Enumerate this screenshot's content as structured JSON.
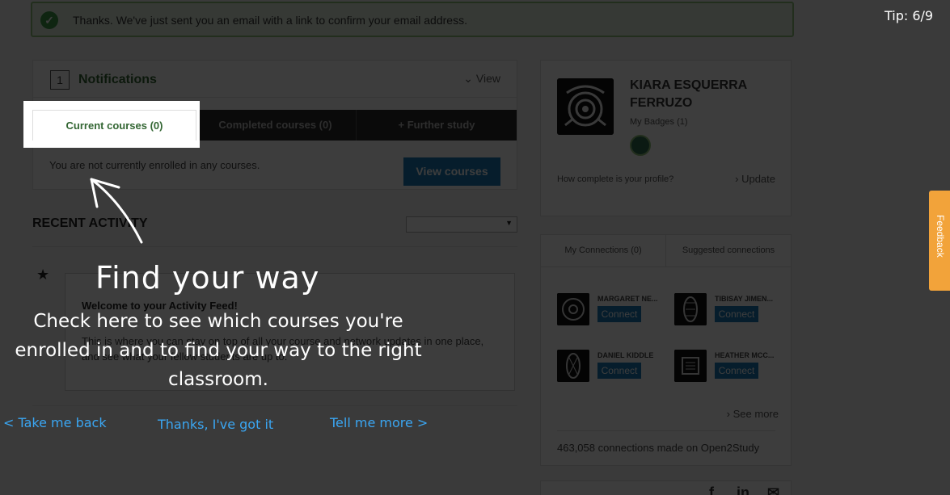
{
  "alert": {
    "message": "Thanks. We've just sent you an email with a link to confirm your email address."
  },
  "notifications": {
    "count": "1",
    "title": "Notifications",
    "view_label": "View",
    "tabs": [
      "Current courses (0)",
      "Completed courses (0)",
      "+ Further study"
    ],
    "empty_text": "You are not currently enrolled in any courses.",
    "view_courses_label": "View courses"
  },
  "activity": {
    "title": "RECENT ACTIVITY",
    "feed_title": "Welcome to your Activity Feed!",
    "feed_text": "This is where you can stay on top of all your course and network updates in one place, and see what your fellow students are up to."
  },
  "profile": {
    "name": "KIARA ESQUERRA FERRUZO",
    "badges_label": "My Badges (1)",
    "complete_question": "How complete is your profile?",
    "update_label": "Update"
  },
  "connections": {
    "tabs": [
      "My Connections (0)",
      "Suggested connections"
    ],
    "people": [
      {
        "name": "MARGARET NE...",
        "action": "Connect"
      },
      {
        "name": "TIBISAY JIMEN...",
        "action": "Connect"
      },
      {
        "name": "DANIEL KIDDLE",
        "action": "Connect"
      },
      {
        "name": "HEATHER MCC...",
        "action": "Connect"
      }
    ],
    "see_more": "See more",
    "total_text": "463,058 connections made on Open2Study"
  },
  "tip": {
    "counter": "Tip: 6/9",
    "title": "Find your way",
    "body": "Check here to see which courses you're enrolled in and to find your way to the right classroom.",
    "back": "< Take me back",
    "got_it": "Thanks, I've got it",
    "more": "Tell me more >"
  },
  "feedback_label": "Feedback",
  "icons": [
    "check-icon",
    "chevron-down-icon",
    "chevron-right-icon",
    "star-icon",
    "facebook-icon",
    "linkedin-icon",
    "email-icon",
    "tip-arrow"
  ]
}
